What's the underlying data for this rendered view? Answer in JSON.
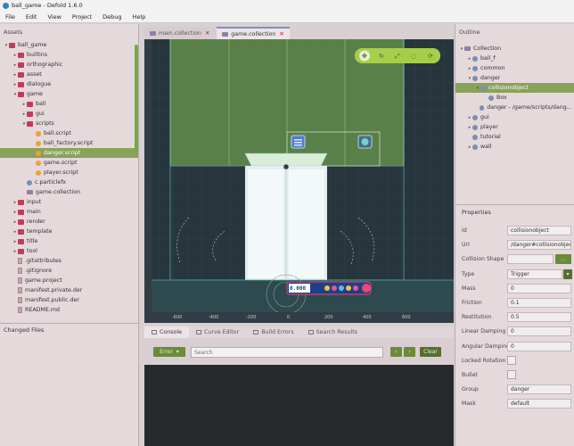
{
  "window": {
    "title": "ball_game - Defold 1.6.0"
  },
  "menu": [
    "File",
    "Edit",
    "View",
    "Project",
    "Debug",
    "Help"
  ],
  "assets": {
    "title": "Assets",
    "tree": [
      {
        "label": "ball_game",
        "depth": 0,
        "icon": "folder",
        "tw": "▾"
      },
      {
        "label": "builtins",
        "depth": 1,
        "icon": "folder",
        "tw": "▸"
      },
      {
        "label": "orthographic",
        "depth": 1,
        "icon": "folder",
        "tw": "▸"
      },
      {
        "label": "asset",
        "depth": 1,
        "icon": "folder",
        "tw": "▸"
      },
      {
        "label": "dialogue",
        "depth": 1,
        "icon": "folder",
        "tw": "▸"
      },
      {
        "label": "game",
        "depth": 1,
        "icon": "folder",
        "tw": "▾"
      },
      {
        "label": "ball",
        "depth": 2,
        "icon": "folder",
        "tw": "▸"
      },
      {
        "label": "gui",
        "depth": 2,
        "icon": "folder",
        "tw": "▸"
      },
      {
        "label": "scripts",
        "depth": 2,
        "icon": "folder",
        "tw": "▾"
      },
      {
        "label": "ball.script",
        "depth": 3,
        "icon": "script",
        "tw": ""
      },
      {
        "label": "ball_factory.script",
        "depth": 3,
        "icon": "script",
        "tw": ""
      },
      {
        "label": "danger.script",
        "depth": 3,
        "icon": "script",
        "tw": "",
        "selected": true
      },
      {
        "label": "game.script",
        "depth": 3,
        "icon": "script",
        "tw": ""
      },
      {
        "label": "player.script",
        "depth": 3,
        "icon": "script",
        "tw": ""
      },
      {
        "label": "c.particlefx",
        "depth": 2,
        "icon": "px",
        "tw": ""
      },
      {
        "label": "game.collection",
        "depth": 2,
        "icon": "coll",
        "tw": ""
      },
      {
        "label": "input",
        "depth": 1,
        "icon": "folder",
        "tw": "▸"
      },
      {
        "label": "main",
        "depth": 1,
        "icon": "folder",
        "tw": "▸"
      },
      {
        "label": "render",
        "depth": 1,
        "icon": "folder",
        "tw": "▸"
      },
      {
        "label": "template",
        "depth": 1,
        "icon": "folder",
        "tw": "▸"
      },
      {
        "label": "title",
        "depth": 1,
        "icon": "folder",
        "tw": "▸"
      },
      {
        "label": "tool",
        "depth": 1,
        "icon": "folder",
        "tw": "▸"
      },
      {
        "label": ".gitattributes",
        "depth": 1,
        "icon": "file",
        "tw": ""
      },
      {
        "label": ".gitignore",
        "depth": 1,
        "icon": "file",
        "tw": ""
      },
      {
        "label": "game.project",
        "depth": 1,
        "icon": "file",
        "tw": ""
      },
      {
        "label": "manifest.private.der",
        "depth": 1,
        "icon": "file",
        "tw": ""
      },
      {
        "label": "manifest.public.der",
        "depth": 1,
        "icon": "file",
        "tw": ""
      },
      {
        "label": "README.md",
        "depth": 1,
        "icon": "file",
        "tw": ""
      }
    ]
  },
  "changed_files": {
    "title": "Changed Files"
  },
  "tabs": [
    {
      "label": "main.collection",
      "active": false
    },
    {
      "label": "game.collection",
      "active": true
    }
  ],
  "viewport": {
    "ruler_labels": [
      "-600",
      "-400",
      "-200",
      "0",
      "200",
      "400",
      "600"
    ],
    "hud_number": "0.000"
  },
  "bottom": {
    "tabs": [
      "Console",
      "Curve Editor",
      "Build Errors",
      "Search Results"
    ],
    "filter_label": "Error",
    "search_placeholder": "Search",
    "clear_label": "Clear"
  },
  "outline": {
    "title": "Outline",
    "tree": [
      {
        "label": "Collection",
        "depth": 0,
        "tw": "▾"
      },
      {
        "label": "ball_f",
        "depth": 1,
        "tw": "▸"
      },
      {
        "label": "common",
        "depth": 1,
        "tw": "▸"
      },
      {
        "label": "danger",
        "depth": 1,
        "tw": "▾"
      },
      {
        "label": "collisionobject",
        "depth": 2,
        "tw": "▾",
        "selected": true
      },
      {
        "label": "Box",
        "depth": 3,
        "tw": ""
      },
      {
        "label": "danger - /game/scripts/danger.script",
        "depth": 2,
        "tw": ""
      },
      {
        "label": "gui",
        "depth": 1,
        "tw": "▸"
      },
      {
        "label": "player",
        "depth": 1,
        "tw": "▸"
      },
      {
        "label": "tutorial",
        "depth": 1,
        "tw": ""
      },
      {
        "label": "wall",
        "depth": 1,
        "tw": "▸"
      }
    ]
  },
  "properties": {
    "title": "Properties",
    "rows": [
      {
        "label": "Id",
        "value": "collisionobject",
        "kind": "text"
      },
      {
        "label": "Url",
        "value": "/danger#collisionobject",
        "kind": "text"
      },
      {
        "label": "Collision Shape",
        "value": "",
        "kind": "resource"
      },
      {
        "label": "Type",
        "value": "Trigger",
        "kind": "select"
      },
      {
        "label": "Mass",
        "value": "0",
        "kind": "text"
      },
      {
        "label": "Friction",
        "value": "0.1",
        "kind": "text"
      },
      {
        "label": "Restitution",
        "value": "0.5",
        "kind": "text"
      },
      {
        "label": "Linear Damping",
        "value": "0",
        "kind": "text"
      },
      {
        "label": "Angular Damping",
        "value": "0",
        "kind": "text"
      },
      {
        "label": "Locked Rotation",
        "value": "",
        "kind": "check"
      },
      {
        "label": "Bullet",
        "value": "",
        "kind": "check"
      },
      {
        "label": "Group",
        "value": "danger",
        "kind": "text"
      },
      {
        "label": "Mask",
        "value": "default",
        "kind": "text"
      }
    ]
  },
  "colors": {
    "accent": "#6a8b3a",
    "selection": "#8aa15a",
    "folder": "#c43a58",
    "viewport_bg": "#27363d"
  }
}
